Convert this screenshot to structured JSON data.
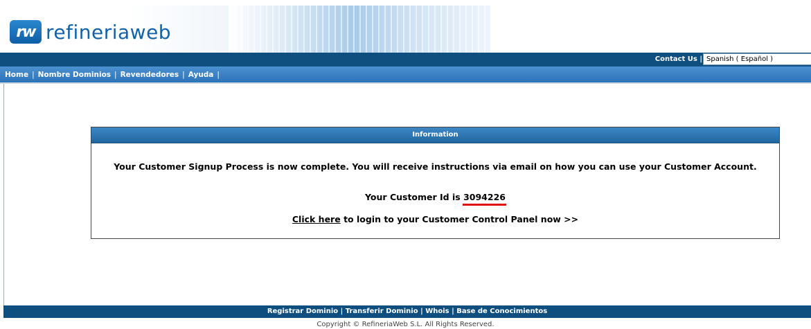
{
  "logo": {
    "mark": "rw",
    "text": "refineriaweb"
  },
  "topbar": {
    "contact": "Contact Us |",
    "language": "Spanish ( Español )"
  },
  "nav": {
    "items": [
      "Home",
      "Nombre Dominios",
      "Revendedores",
      "Ayuda"
    ]
  },
  "info": {
    "title": "Information",
    "message": "Your Customer Signup Process is now complete. You will receive instructions via email on how you can use your Customer Account.",
    "customer_id_label": "Your Customer Id is",
    "customer_id": "3094226",
    "login_link": "Click here",
    "login_text": "to login to your Customer Control Panel now >>"
  },
  "footer": {
    "links": [
      "Registrar Dominio",
      "Transferir Dominio",
      "Whois",
      "Base de Conocimientos"
    ],
    "copyright": "Copyright © RefineriaWeb S.L. All Rights Reserved."
  },
  "colors": {
    "dark_blue": "#0e4f80",
    "nav_blue": "#2b73b8",
    "underline_red": "#e01010"
  }
}
